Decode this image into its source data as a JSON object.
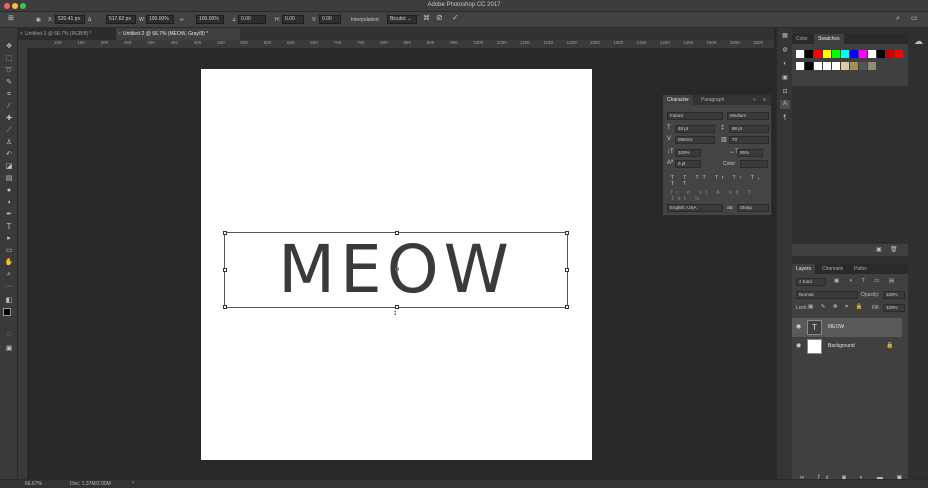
{
  "window": {
    "title": "Adobe Photoshop CC 2017"
  },
  "options": {
    "x_label": "X:",
    "x_value": "520.41 px",
    "y_value": "517.62 px",
    "w_label": "W:",
    "w_value": "100.00%",
    "h_value": "100.00%",
    "rot_value": "0.00",
    "hskew_label": "H:",
    "hskew_value": "0.00",
    "vskew_label": "V:",
    "vskew_value": "0.00",
    "interp_label": "Interpolation:",
    "interp_value": "Bicubic"
  },
  "tabs": [
    {
      "label": "Untitled-1 @ 66.7% (RGB/8) *"
    },
    {
      "label": "Untitled-2 @ 66.7% (MEOW, Gray/8) *"
    }
  ],
  "ruler": [
    "100",
    "150",
    "200",
    "250",
    "300",
    "350",
    "400",
    "450",
    "500",
    "550",
    "600",
    "650",
    "700",
    "750",
    "800",
    "850",
    "900",
    "950",
    "1000",
    "1050",
    "1100",
    "1150",
    "1200",
    "1250",
    "1300",
    "1350",
    "1400",
    "1450",
    "1500",
    "1550",
    "1600",
    "1650",
    "1700"
  ],
  "canvas": {
    "text": "MEOW"
  },
  "character": {
    "tabs": [
      "Character",
      "Paragraph"
    ],
    "font_family": "Futura",
    "font_style": "Medium",
    "size": "48 pt",
    "leading": "88 pt",
    "kerning": "Metrics",
    "tracking": "70",
    "vscale": "100%",
    "hscale": "95%",
    "baseline": "0 pt",
    "color_label": "Color:",
    "language": "English: USA",
    "aa_label": "aa",
    "aa_value": "Sharp"
  },
  "swatches": {
    "tabs": [
      "Color",
      "Swatches"
    ],
    "colors": [
      "#ffffff",
      "#000000",
      "#ff0000",
      "#ffff00",
      "#00ff00",
      "#00ffff",
      "#0000ff",
      "#ff00ff",
      "#ffffff",
      "#000000",
      "#cc0000",
      "#ff0000",
      "#ffffff",
      "#000000",
      "#ffffff",
      "#ffffff",
      "#ffffff",
      "#d8cfa8",
      "#a38f57",
      "#555555",
      "#8f8f6f"
    ]
  },
  "layers": {
    "tabs": [
      "Layers",
      "Channels",
      "Paths"
    ],
    "filter_label": "Kind",
    "blend_mode": "Normal",
    "opacity_label": "Opacity:",
    "opacity_value": "100%",
    "lock_label": "Lock:",
    "fill_label": "Fill:",
    "fill_value": "100%",
    "items": [
      {
        "name": "MEOW"
      },
      {
        "name": "Background"
      }
    ]
  },
  "status": {
    "zoom": "66.67%",
    "doc": "Doc: 1.37M/2.00M"
  }
}
